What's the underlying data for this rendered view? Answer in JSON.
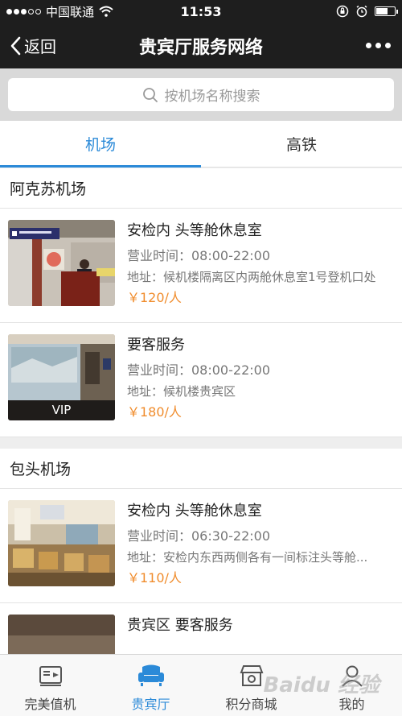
{
  "status_bar": {
    "carrier": "中国联通",
    "time": "11:53"
  },
  "nav": {
    "back_label": "返回",
    "title": "贵宾厅服务网络",
    "more_icon": "more-dots-icon"
  },
  "search": {
    "placeholder": "按机场名称搜索"
  },
  "tabs": [
    {
      "label": "机场",
      "active": true
    },
    {
      "label": "高铁",
      "active": false
    }
  ],
  "sections": [
    {
      "name": "阿克苏机场",
      "items": [
        {
          "title": "安检内 头等舱休息室",
          "hours": "营业时间：08:00-22:00",
          "address": "地址：候机楼隔离区内两舱休息室1号登机口处",
          "price": "￥120/人"
        },
        {
          "title": "要客服务",
          "hours": "营业时间：08:00-22:00",
          "address": "地址：候机楼贵宾区",
          "price": "￥180/人",
          "thumb_label": "VIP"
        }
      ]
    },
    {
      "name": "包头机场",
      "items": [
        {
          "title": "安检内 头等舱休息室",
          "hours": "营业时间：06:30-22:00",
          "address": "地址：安检内东西两侧各有一间标注头等舱...",
          "price": "￥110/人"
        },
        {
          "title": "贵宾区 要客服务",
          "hours": "",
          "address": "",
          "price": ""
        }
      ]
    }
  ],
  "bottom_tabs": [
    {
      "label": "完美值机",
      "icon": "boarding-pass-icon",
      "active": false
    },
    {
      "label": "贵宾厅",
      "icon": "sofa-icon",
      "active": true
    },
    {
      "label": "积分商城",
      "icon": "mall-icon",
      "active": false
    },
    {
      "label": "我的",
      "icon": "user-icon",
      "active": false
    }
  ],
  "watermark": "Baidu 经验",
  "colors": {
    "accent": "#2b8ad8",
    "price": "#f08c2c",
    "header_bg": "#1e1e1e"
  }
}
